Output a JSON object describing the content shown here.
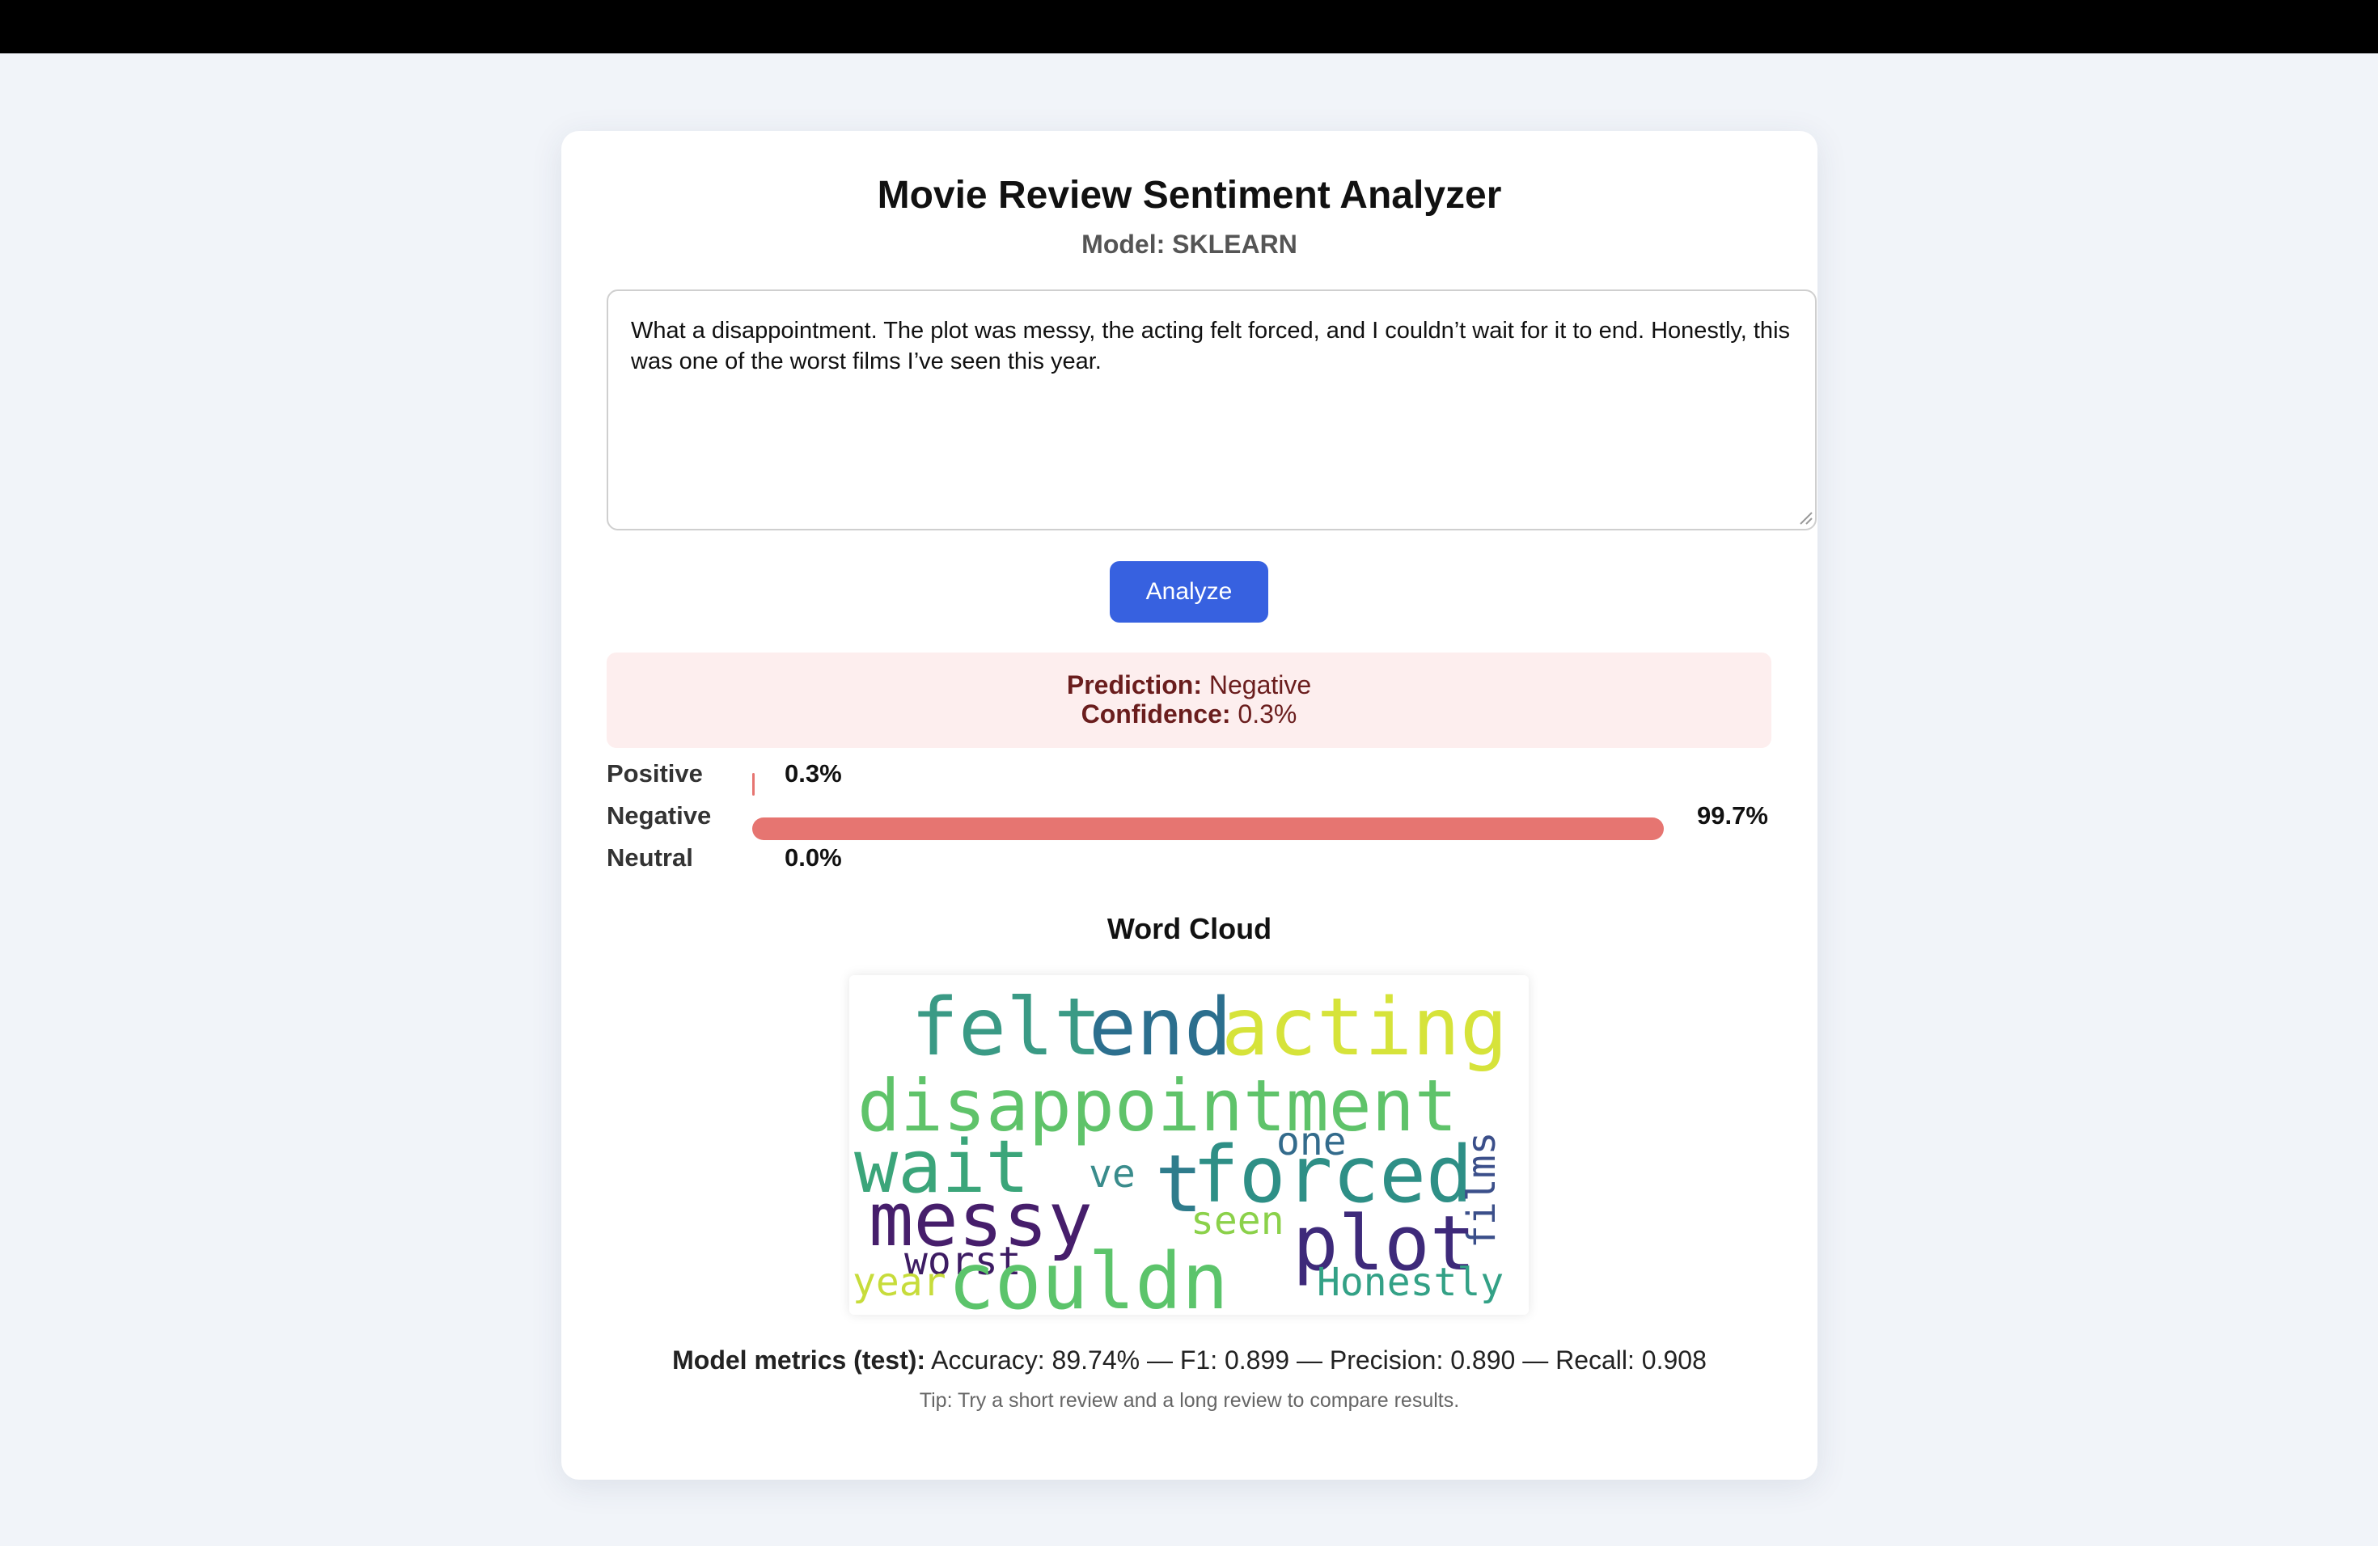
{
  "app": {
    "title": "Movie Review Sentiment Analyzer",
    "model_label": "Model: SKLEARN"
  },
  "review": {
    "text": "What a disappointment. The plot was messy, the acting felt forced, and I couldn’t wait for it to end. Honestly, this was one of the worst films I’ve seen this year."
  },
  "analyze_button": {
    "label": "Analyze"
  },
  "result": {
    "prediction_label": "Prediction:",
    "prediction_value": "Negative",
    "confidence_label": "Confidence:",
    "confidence_value": "0.3%"
  },
  "probabilities": [
    {
      "label": "Positive",
      "value_text": "0.3%",
      "fraction": 0.003,
      "color": "#e67571"
    },
    {
      "label": "Negative",
      "value_text": "99.7%",
      "fraction": 0.997,
      "color": "#e67571"
    },
    {
      "label": "Neutral",
      "value_text": "0.0%",
      "fraction": 0.0,
      "color": "#e67571"
    }
  ],
  "word_cloud": {
    "title": "Word Cloud",
    "words": [
      {
        "text": "felt",
        "color": "#3a9a85",
        "vertical": false
      },
      {
        "text": "end",
        "color": "#2c6f8e",
        "vertical": false
      },
      {
        "text": "acting",
        "color": "#d6e33a",
        "vertical": false
      },
      {
        "text": "disappointment",
        "color": "#5fc36a",
        "vertical": false
      },
      {
        "text": "wait",
        "color": "#3ba57a",
        "vertical": false
      },
      {
        "text": "one",
        "color": "#336b8c",
        "vertical": false
      },
      {
        "text": "ve",
        "color": "#3a8c8c",
        "vertical": false
      },
      {
        "text": "t",
        "color": "#2f7c8c",
        "vertical": false
      },
      {
        "text": "forced",
        "color": "#2e8f86",
        "vertical": false
      },
      {
        "text": "films",
        "color": "#3b4f8a",
        "vertical": true
      },
      {
        "text": "messy",
        "color": "#461e6b",
        "vertical": false
      },
      {
        "text": "seen",
        "color": "#8bd14a",
        "vertical": false
      },
      {
        "text": "plot",
        "color": "#3e2a7a",
        "vertical": false
      },
      {
        "text": "worst",
        "color": "#3d1c63",
        "vertical": false
      },
      {
        "text": "year",
        "color": "#c7dc3b",
        "vertical": false
      },
      {
        "text": "couldn",
        "color": "#5cc46b",
        "vertical": false
      },
      {
        "text": "Honestly",
        "color": "#33a186",
        "vertical": false
      }
    ]
  },
  "metrics": {
    "label": "Model metrics (test):",
    "text": " Accuracy: 89.74%  —  F1: 0.899  —  Precision: 0.890  —  Recall: 0.908"
  },
  "tip": "Tip: Try a short review and a long review to compare results."
}
